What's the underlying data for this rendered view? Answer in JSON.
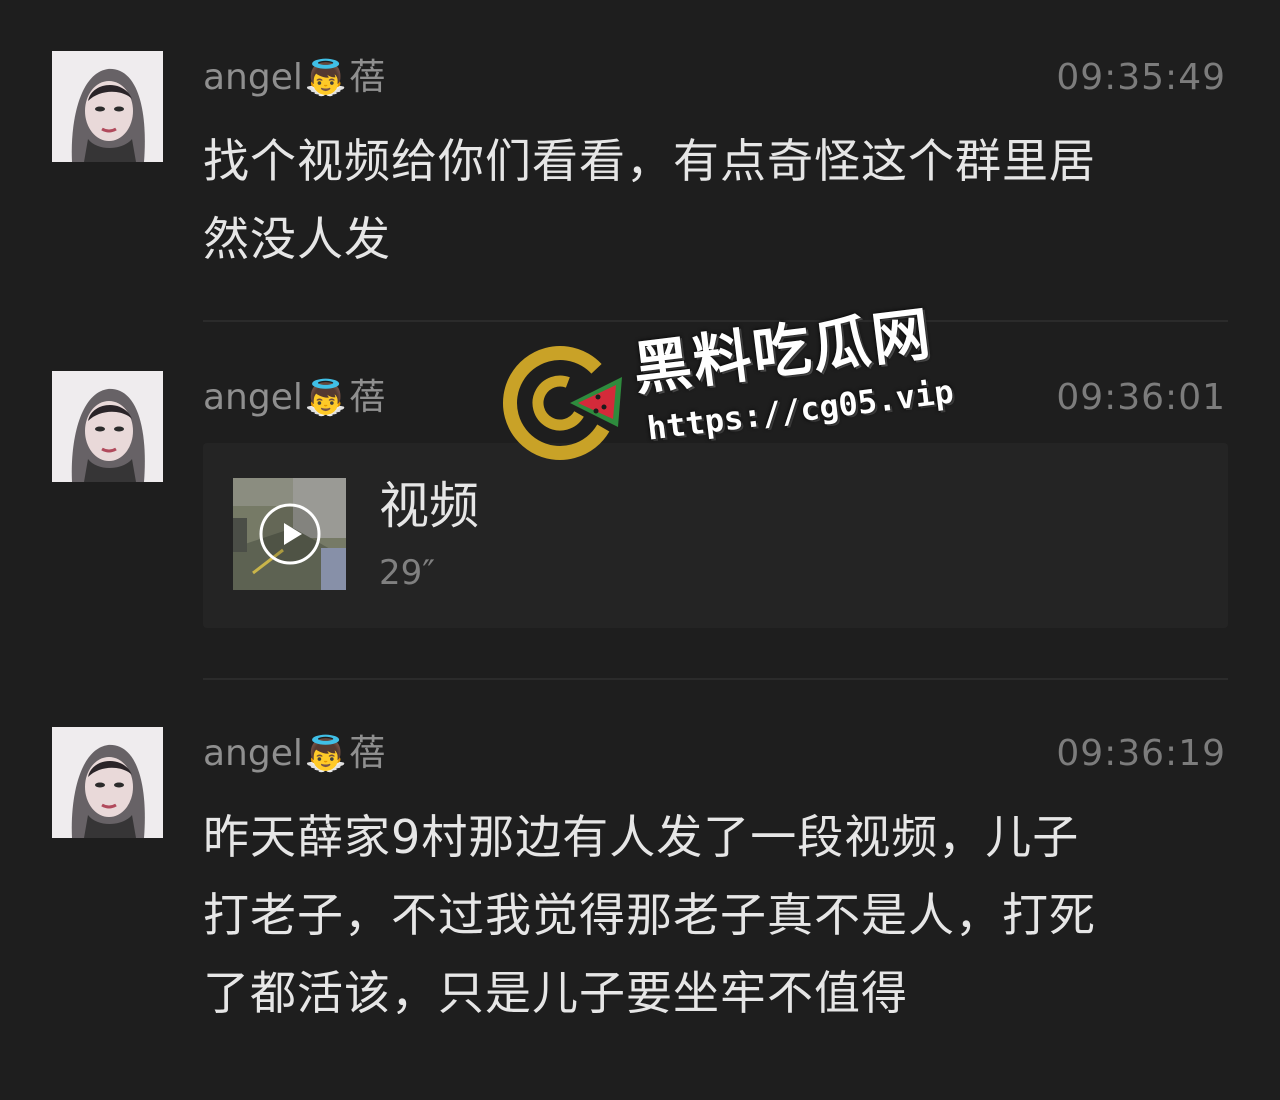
{
  "messages": [
    {
      "sender": "angel",
      "sender_suffix": "蓓",
      "sender_emoji": "👼",
      "time": "09:35:49",
      "text_lines": [
        "找个视频给你们看看，有点奇怪这个群里居",
        "然没人发"
      ]
    },
    {
      "sender": "angel",
      "sender_suffix": "蓓",
      "sender_emoji": "👼",
      "time": "09:36:01",
      "video": {
        "title": "视频",
        "duration": "29″"
      }
    },
    {
      "sender": "angel",
      "sender_suffix": "蓓",
      "sender_emoji": "👼",
      "time": "09:36:19",
      "text_lines": [
        "昨天薛家9村那边有人发了一段视频，儿子",
        "打老子，不过我觉得那老子真不是人，打死",
        "了都活该，只是儿子要坐牢不值得"
      ]
    }
  ],
  "watermark": {
    "title": "黑料吃瓜网",
    "url": "https://cg05.vip"
  },
  "colors": {
    "background": "#1e1e1e",
    "text": "#e6e6e6",
    "meta": "#8f8f8f",
    "logo_gold": "#c9a227",
    "logo_green": "#2e8b3d",
    "logo_red": "#d42a3a"
  }
}
